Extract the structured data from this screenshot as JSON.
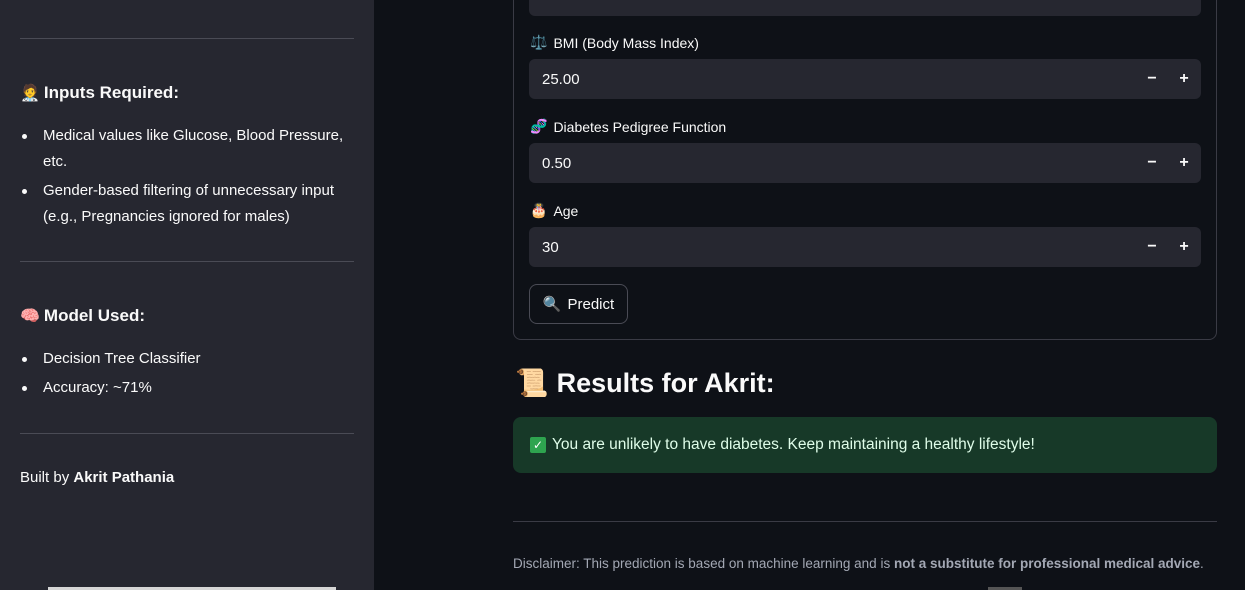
{
  "sidebar": {
    "inputs_heading_emoji": "🧑‍⚕️",
    "inputs_heading": "Inputs Required:",
    "inputs_items": [
      "Medical values like Glucose, Blood Pressure, etc.",
      "Gender-based filtering of unnecessary input (e.g., Pregnancies ignored for males)"
    ],
    "model_heading_emoji": "🧠",
    "model_heading": "Model Used:",
    "model_items": [
      "Decision Tree Classifier",
      "Accuracy: ~71%"
    ],
    "built_prefix": "Built by ",
    "built_author": "Akrit Pathania"
  },
  "form": {
    "bmi": {
      "icon": "⚖️",
      "label": "BMI (Body Mass Index)",
      "value": "25.00"
    },
    "dpf": {
      "icon": "🧬",
      "label": "Diabetes Pedigree Function",
      "value": "0.50"
    },
    "age": {
      "icon": "🎂",
      "label": "Age",
      "value": "30"
    },
    "minus": "−",
    "plus": "+",
    "predict_icon": "🔍",
    "predict_label": "Predict"
  },
  "results": {
    "icon": "📜",
    "title": "Results for Akrit:",
    "message": "You are unlikely to have diabetes. Keep maintaining a healthy lifestyle!"
  },
  "disclaimer": {
    "prefix": "Disclaimer: This prediction is based on machine learning and is ",
    "bold": "not a substitute for professional medical advice",
    "suffix": "."
  },
  "colors": {
    "sidebar_bg": "#262730",
    "main_bg": "#0e1117",
    "success_bg": "#173928"
  }
}
